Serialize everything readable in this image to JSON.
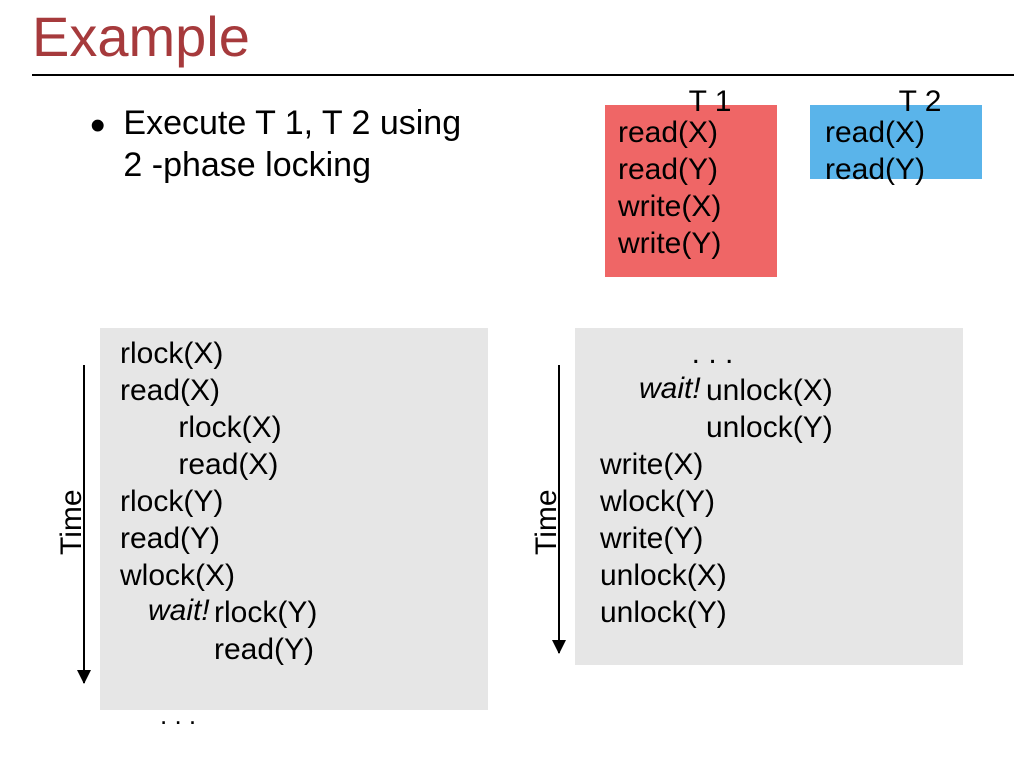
{
  "title": "Example",
  "bullet": {
    "line1": "Execute T 1, T 2 using",
    "line2": "2 -phase locking"
  },
  "t1": {
    "header": "T 1",
    "lines": "read(X)\nread(Y)\nwrite(X)\nwrite(Y)"
  },
  "t2": {
    "header": "T 2",
    "lines": "read(X)\nread(Y)"
  },
  "time_label": "Time",
  "sched_left": {
    "main": "rlock(X)\nread(X)\n       rlock(X)\n       read(X)\nrlock(Y)\nread(Y)\nwlock(X)",
    "wait": "wait!",
    "overlay": "rlock(Y)\nread(Y)",
    "ellipsis": ". . ."
  },
  "sched_right": {
    "top": "           . . .",
    "wait": "wait!",
    "overlay": "unlock(X)\nunlock(Y)",
    "main": "write(X)\nwlock(Y)\nwrite(Y)\nunlock(X)\nunlock(Y)"
  }
}
